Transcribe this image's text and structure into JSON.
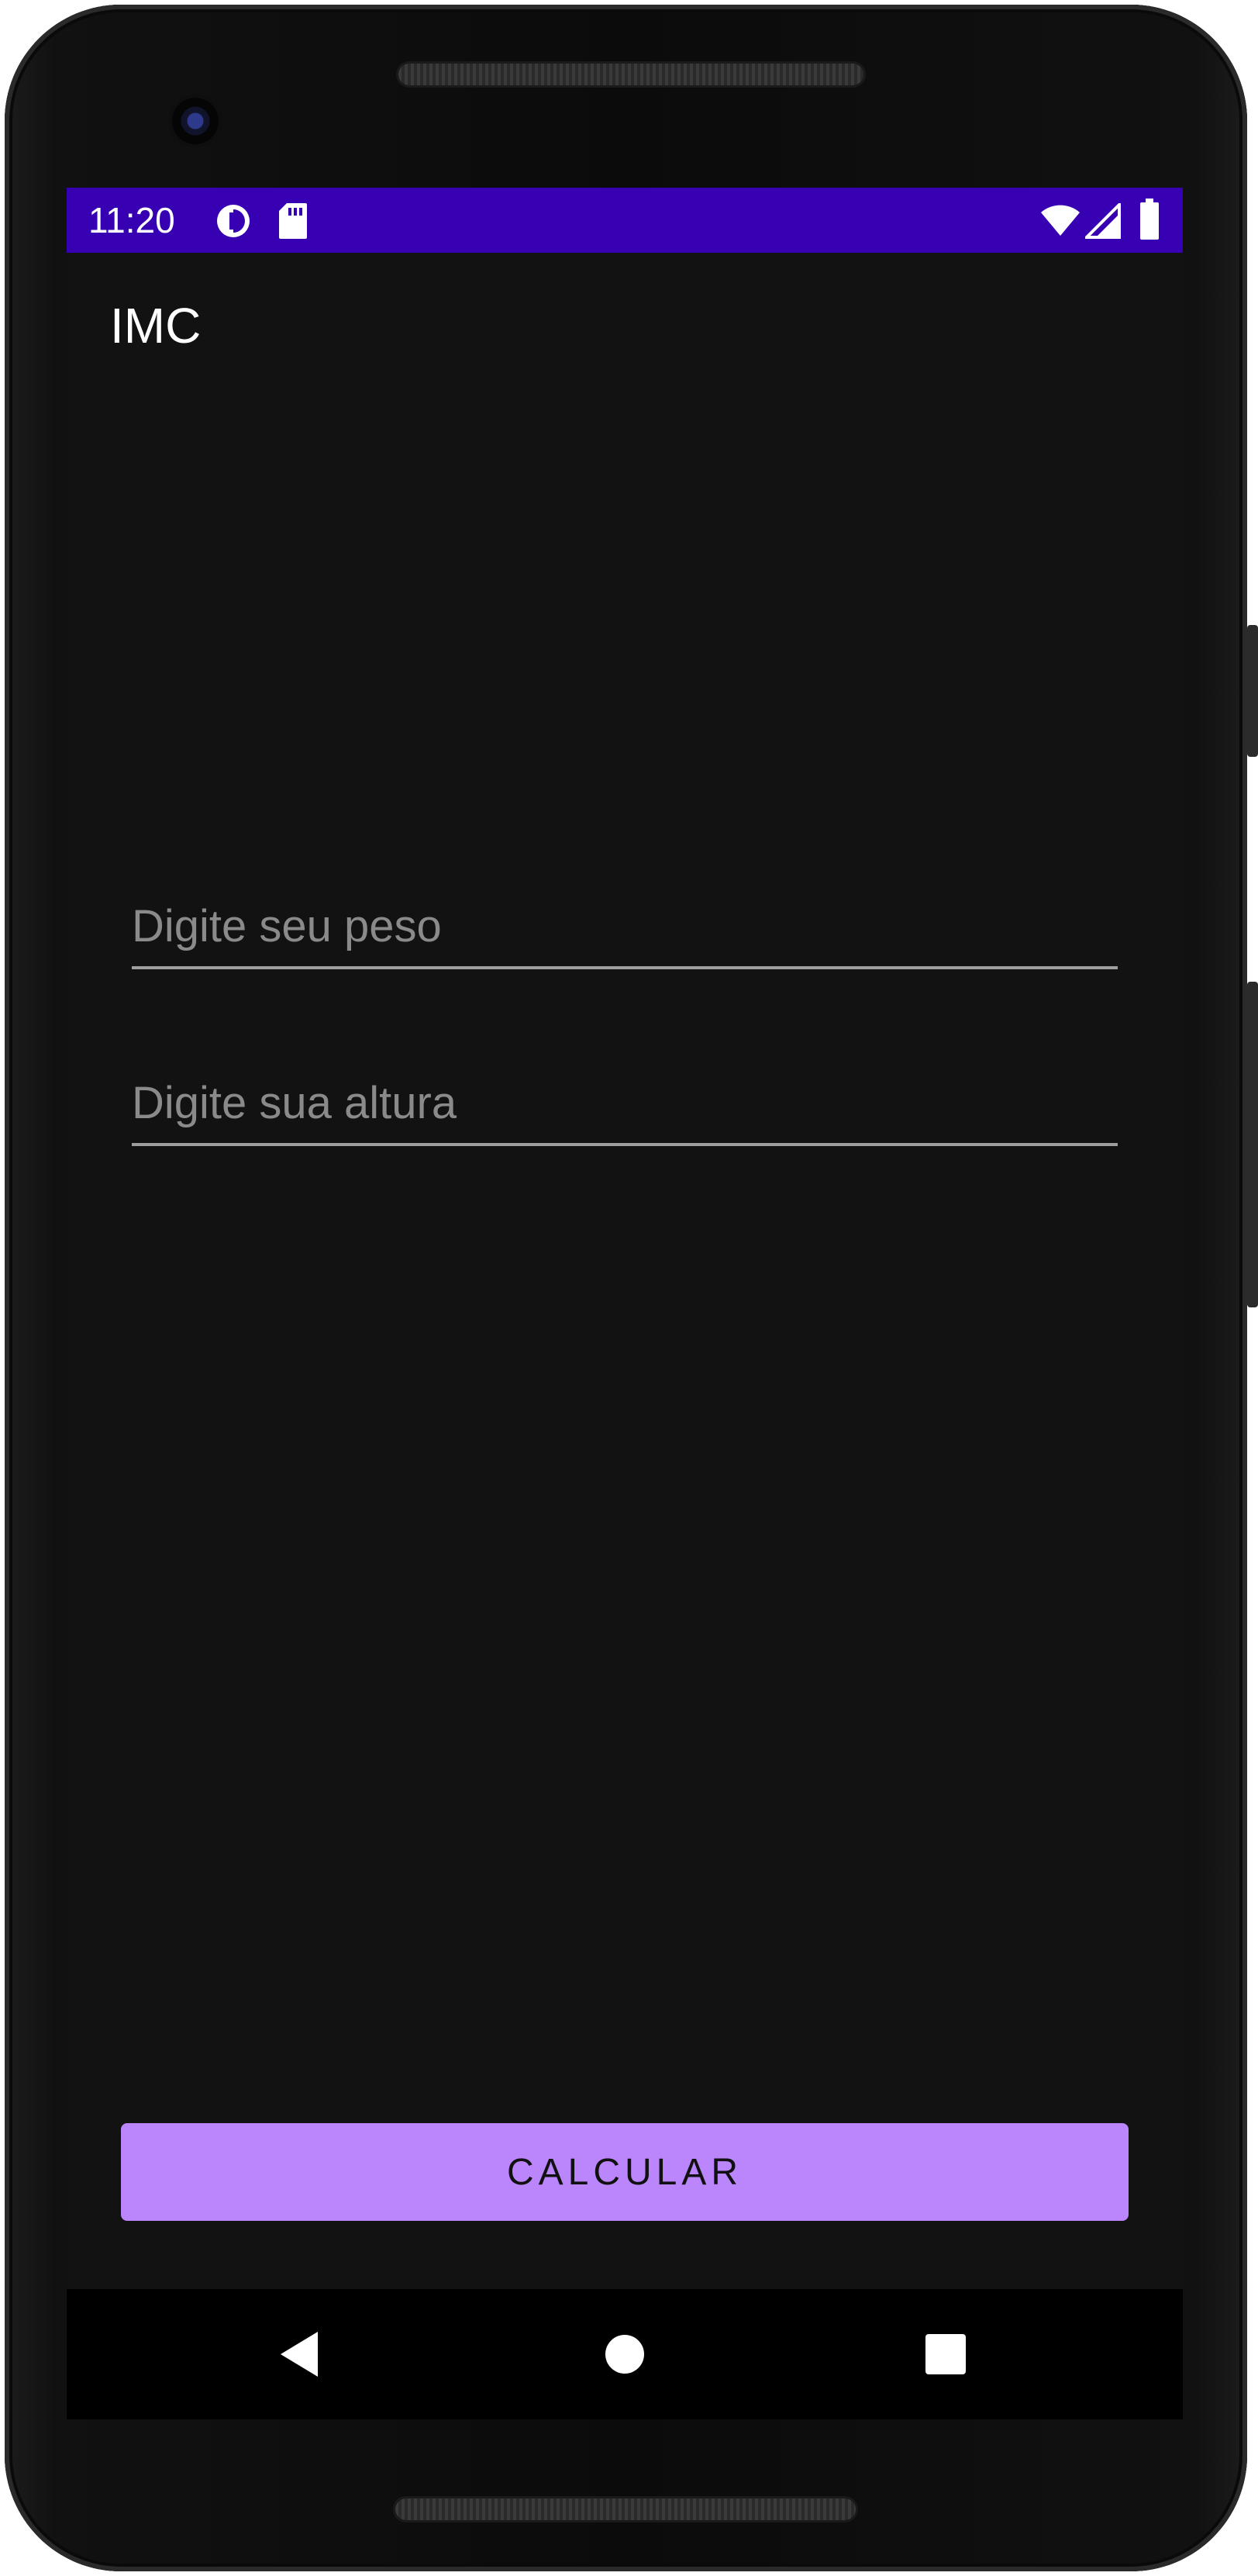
{
  "status_bar": {
    "time": "11:20",
    "left_icons": [
      "data-saver-icon",
      "sd-card-icon"
    ],
    "right_icons": [
      "wifi-icon",
      "cell-signal-icon",
      "battery-icon"
    ],
    "background_color": "#3700b3"
  },
  "app_bar": {
    "title": "IMC"
  },
  "form": {
    "weight_placeholder": "Digite seu peso",
    "weight_value": "",
    "height_placeholder": "Digite sua altura",
    "height_value": ""
  },
  "actions": {
    "calculate_label": "CALCULAR",
    "button_color": "#bb86fc"
  },
  "nav_bar": {
    "buttons": [
      "back-icon",
      "home-icon",
      "recents-icon"
    ]
  },
  "theme": {
    "background": "#121212",
    "text": "#ffffff",
    "hint": "#8a8a8a"
  }
}
